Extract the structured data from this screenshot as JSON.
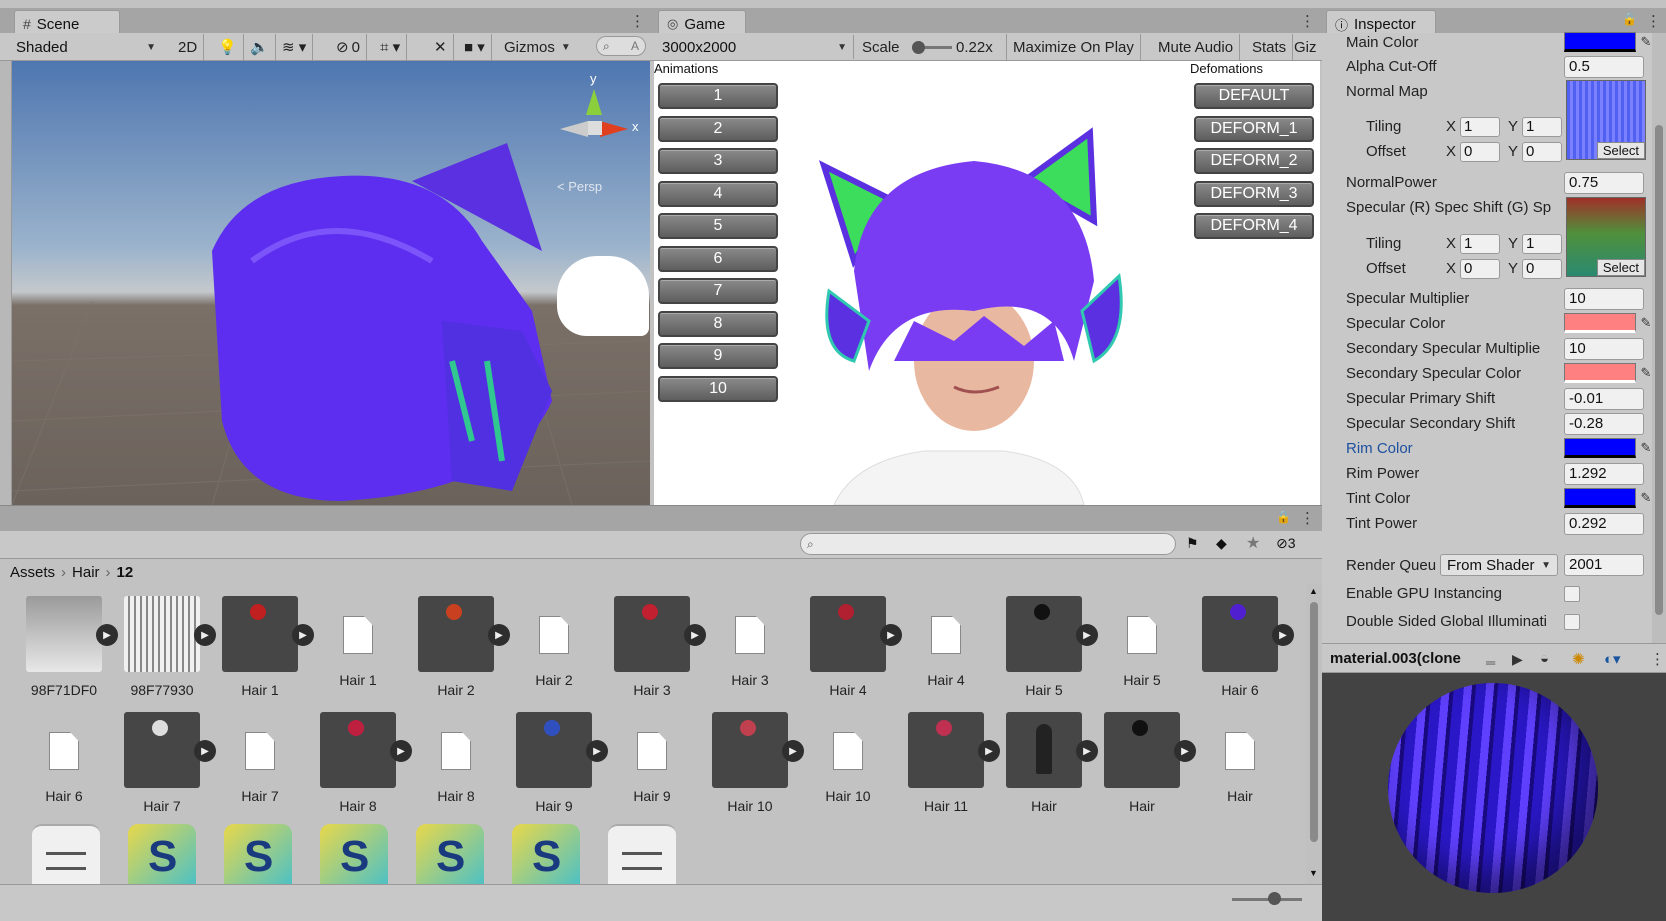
{
  "scene": {
    "tab": "Scene",
    "shading": "Shaded",
    "btn2d": "2D",
    "hidden_count": "0",
    "gizmos": "Gizmos",
    "search": "A",
    "axis_y": "y",
    "axis_x": "x",
    "persp": "< Persp"
  },
  "game": {
    "tab": "Game",
    "resolution": "3000x2000",
    "scale_label": "Scale",
    "scale_value": "0.22x",
    "maximize": "Maximize On Play",
    "mute": "Mute Audio",
    "stats": "Stats",
    "gizmos": "Giz",
    "animations_label": "Animations",
    "deformations_label": "Defomations",
    "anim_buttons": [
      "1",
      "2",
      "3",
      "4",
      "5",
      "6",
      "7",
      "8",
      "9",
      "10"
    ],
    "deform_buttons": [
      "DEFAULT",
      "DEFORM_1",
      "DEFORM_2",
      "DEFORM_3",
      "DEFORM_4"
    ]
  },
  "inspector": {
    "tab": "Inspector",
    "main_color": "Main Color",
    "alpha_cutoff": "Alpha Cut-Off",
    "alpha_cutoff_value": "0.5",
    "normal_map": "Normal Map",
    "tiling": "Tiling",
    "offset": "Offset",
    "x": "X",
    "y": "Y",
    "one": "1",
    "zero": "0",
    "select": "Select",
    "normal_power": "NormalPower",
    "normal_power_value": "0.75",
    "spec_map": "Specular (R) Spec Shift (G) Sp",
    "spec_mult": "Specular Multiplier",
    "spec_mult_value": "10",
    "spec_color": "Specular Color",
    "sec_spec_mult": "Secondary Specular Multiplie",
    "sec_spec_mult_value": "10",
    "sec_spec_color": "Secondary Specular Color",
    "spec_primary_shift": "Specular Primary Shift",
    "spec_primary_shift_value": "-0.01",
    "spec_secondary_shift": "Specular Secondary Shift",
    "spec_secondary_shift_value": "-0.28",
    "rim_color": "Rim Color",
    "rim_power": "Rim Power",
    "rim_power_value": "1.292",
    "tint_color": "Tint Color",
    "tint_power": "Tint Power",
    "tint_power_value": "0.292",
    "render_queue": "Render Queu",
    "render_queue_mode": "From Shader",
    "render_queue_value": "2001",
    "gpu_instancing": "Enable GPU Instancing",
    "double_sided": "Double Sided Global Illuminati",
    "preview_title": "material.003(clone",
    "colors": {
      "blue": "#0000ff",
      "salmon": "#ff8080"
    }
  },
  "project": {
    "hidden_count": "3",
    "breadcrumb": [
      "Assets",
      "Hair",
      "12"
    ],
    "row1": [
      {
        "label": "98F71DF0",
        "kind": "tex"
      },
      {
        "label": "98F77930",
        "kind": "tex2"
      },
      {
        "label": "Hair 1",
        "kind": "mat",
        "orb": "#c02020"
      },
      {
        "label": "Hair 1",
        "kind": "doc"
      },
      {
        "label": "Hair 2",
        "kind": "mat",
        "orb": "#c84020"
      },
      {
        "label": "Hair 2",
        "kind": "doc"
      },
      {
        "label": "Hair 3",
        "kind": "mat",
        "orb": "#c02030"
      },
      {
        "label": "Hair 3",
        "kind": "doc"
      },
      {
        "label": "Hair 4",
        "kind": "mat",
        "orb": "#b02030"
      },
      {
        "label": "Hair 4",
        "kind": "doc"
      },
      {
        "label": "Hair 5",
        "kind": "mat",
        "orb": "#111111"
      },
      {
        "label": "Hair 5",
        "kind": "doc"
      },
      {
        "label": "Hair 6",
        "kind": "mat",
        "orb": "#5020d0"
      }
    ],
    "row2": [
      {
        "label": "Hair 6",
        "kind": "doc"
      },
      {
        "label": "Hair 7",
        "kind": "mat",
        "orb": "#dddddd"
      },
      {
        "label": "Hair 7",
        "kind": "doc"
      },
      {
        "label": "Hair 8",
        "kind": "mat",
        "orb": "#c02040"
      },
      {
        "label": "Hair 8",
        "kind": "doc"
      },
      {
        "label": "Hair 9",
        "kind": "mat",
        "orb": "#3050c0"
      },
      {
        "label": "Hair 9",
        "kind": "doc"
      },
      {
        "label": "Hair 10",
        "kind": "mat",
        "orb": "#c04050"
      },
      {
        "label": "Hair 10",
        "kind": "doc"
      },
      {
        "label": "Hair 11",
        "kind": "mat",
        "orb": "#c03050"
      },
      {
        "label": "Hair",
        "kind": "figure"
      },
      {
        "label": "Hair",
        "kind": "mat",
        "orb": "#111111"
      },
      {
        "label": "Hair",
        "kind": "doc"
      }
    ],
    "row3": [
      "doc",
      "s",
      "s",
      "s",
      "s",
      "s",
      "doc"
    ],
    "shader_letter": "S"
  }
}
